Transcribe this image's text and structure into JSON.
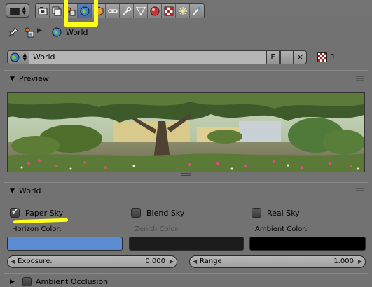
{
  "toolbar": {
    "tabs": [
      "render-icon",
      "render-layers-icon",
      "scene-icon",
      "world-icon",
      "object-icon",
      "constraints-icon",
      "modifiers-icon",
      "data-icon",
      "material-icon",
      "texture-icon",
      "particles-icon",
      "physics-icon"
    ],
    "active_tab": "world-icon",
    "highlight_color": "#ffff1c"
  },
  "breadcrumb": {
    "label": "World"
  },
  "datablock": {
    "name": "World",
    "fake_user": "F",
    "add": "+",
    "remove": "×",
    "users": "1"
  },
  "preview": {
    "title": "Preview"
  },
  "world": {
    "title": "World",
    "paper_sky": "Paper Sky",
    "blend_sky": "Blend Sky",
    "real_sky": "Real Sky",
    "horizon_label": "Horizon Color:",
    "zenith_label": "Zenith Color:",
    "ambient_label": "Ambient Color:",
    "horizon_color": "#5d8bd1",
    "zenith_color": "#1c1c1c",
    "ambient_color": "#000000",
    "exposure_label": "Exposure:",
    "exposure_value": "0.000",
    "range_label": "Range:",
    "range_value": "1.000"
  },
  "ao": {
    "title": "Ambient Occlusion"
  }
}
